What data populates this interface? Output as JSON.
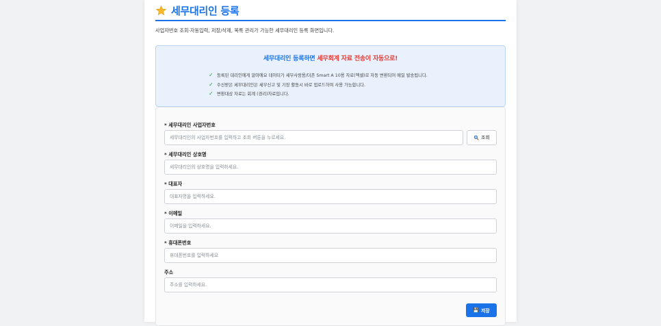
{
  "header": {
    "icon": "star-icon",
    "title": "세무대리인 등록",
    "description": "사업자번호 조회·자동입력, 저장/삭제, 목록 관리가 가능한 세무대리인 등록 화면입니다."
  },
  "notice": {
    "head_part1": "세무대리인 등록하면 ",
    "head_part2": "세무회계 자료 전송이 자동으로!",
    "items": [
      "등록된 대리인에게 알마에요 데이터가 세무사랑용/더존 Smart A 10용 자료(엑셀)로 자동 변환되어 메일 발송됩니다.",
      "수신받은 세무대리인은 세무신고 및 기장 활동시 바로 업로드하여 사용 가능합니다.",
      "변환대상 자료는 회계 (경리)자료입니다."
    ],
    "item_icon": "check-icon"
  },
  "form": {
    "bizno": {
      "label": "* 세무대리인 사업자번호",
      "placeholder": "세무대리인의 사업자번호를 입력하고 조회 버튼을 누르세요.",
      "value": ""
    },
    "lookup_button": {
      "icon": "search-icon",
      "label": "조회"
    },
    "company": {
      "label": "* 세무대리인 상호명",
      "placeholder": "세무대리인의 상호명을 입력하세요.",
      "value": ""
    },
    "ceo": {
      "label": "* 대표자",
      "placeholder": "대표자명을 입력하세요.",
      "value": ""
    },
    "email": {
      "label": "* 이메일",
      "placeholder": "이메일을 입력하세요.",
      "value": ""
    },
    "phone": {
      "label": "* 휴대폰번호",
      "placeholder": "휴대폰번호를 입력하세요",
      "value": ""
    },
    "address": {
      "label": "주소",
      "placeholder": "주소를 입력하세요.",
      "value": ""
    },
    "save_button": {
      "icon": "save-icon",
      "label": "저장"
    }
  },
  "colors": {
    "accent": "#1a73e8",
    "highlight": "#e53935",
    "check": "#2e9a48",
    "notice_bg": "#e8f1fc"
  }
}
